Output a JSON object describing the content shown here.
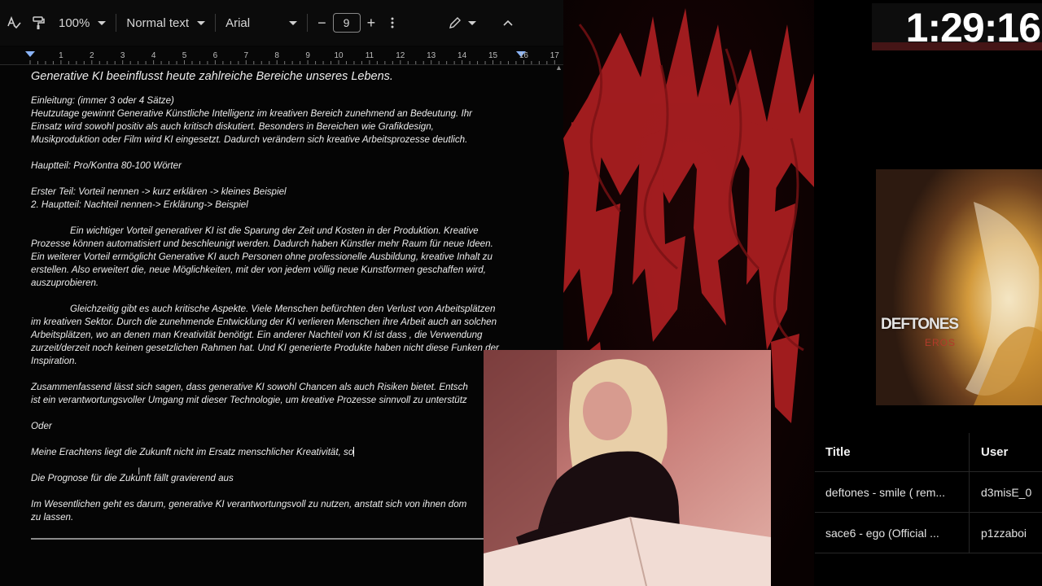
{
  "toolbar": {
    "zoom": "100%",
    "style": "Normal text",
    "font": "Arial",
    "font_size": "9",
    "minus": "−",
    "plus": "+"
  },
  "ruler": {
    "ticks": [
      "1",
      "2",
      "3",
      "4",
      "5",
      "6",
      "7",
      "8",
      "9",
      "10",
      "11",
      "12",
      "13",
      "14",
      "15",
      "16",
      "17"
    ]
  },
  "document": {
    "title": "Generative KI beeinflusst heute zahlreiche Bereiche unseres Lebens.",
    "intro_heading": "Einleitung: (immer 3 oder 4 Sätze)",
    "intro_1": "Heutzutage gewinnt Generative Künstliche Intelligenz im kreativen Bereich zunehmend an Bedeutung. Ihr",
    "intro_2": "Einsatz wird sowohl positiv als auch kritisch diskutiert. Besonders in Bereichen wie Grafikdesign,",
    "intro_3": "Musikproduktion oder Film wird KI eingesetzt. Dadurch verändern sich kreative Arbeitsprozesse deutlich.",
    "main_heading": "Hauptteil: Pro/Kontra 80-100 Wörter",
    "first_part": "Erster Teil: Vorteil nennen -> kurz erklären -> kleines Beispiel",
    "second_part": "2. Hauptteil: Nachteil nennen-> Erklärung-> Beispiel",
    "pro_1": "Ein wichtiger Vorteil generativer KI ist die Sparung der Zeit und Kosten in der Produktion. Kreative",
    "pro_2": "Prozesse können automatisiert und beschleunigt werden. Dadurch haben Künstler mehr Raum für neue Ideen.",
    "pro_3": "Ein weiterer Vorteil ermöglicht Generative KI auch Personen ohne professionelle Ausbildung, kreative Inhalt zu",
    "pro_4": "erstellen. Also erweitert die, neue Möglichkeiten, mit der von jedem völlig neue Kunstformen geschaffen wird,",
    "pro_5": "auszuprobieren.",
    "con_1": "Gleichzeitig gibt es auch kritische Aspekte. Viele Menschen befürchten den Verlust von Arbeitsplätzen",
    "con_2": "im kreativen Sektor. Durch die zunehmende Entwicklung der KI verlieren Menschen ihre Arbeit auch an solchen",
    "con_3": "Arbeitsplätzen, wo an denen man Kreativität benötigt. Ein anderer Nachteil von KI ist dass , die Verwendung",
    "con_4": "zurzeit/derzeit noch keinen gesetzlichen Rahmen hat. Und KI generierte Produkte haben nicht diese Funken der",
    "con_5": "Inspiration.",
    "sum_1": "Zusammenfassend lässt sich sagen, dass generative KI sowohl Chancen als auch Risiken bietet. Entsch",
    "sum_2": "ist ein verantwortungsvoller Umgang mit dieser Technologie, um kreative Prozesse sinnvoll zu unterstütz",
    "oder": "Oder",
    "alt_1": "Meine Erachtens liegt die Zukunft nicht im Ersatz menschlicher Kreativität, so",
    "alt_2": "Die Prognose für die Zukunft fällt gravierend aus",
    "alt_3a": "Im Wesentlichen geht es darum, generative KI verantwortungsvoll zu nutzen, anstatt sich von ihnen dom",
    "alt_3b": "zu lassen."
  },
  "timer": "1:29:16",
  "album": {
    "band": "DEFTONES",
    "subtitle": "EROS"
  },
  "song_table": {
    "headers": [
      "Title",
      "User"
    ],
    "rows": [
      {
        "title": "deftones - smile ( rem...",
        "user": "d3misE_0"
      },
      {
        "title": "sace6 - ego (Official ...",
        "user": "p1zzaboi"
      }
    ]
  },
  "colors": {
    "poster_red": "#b01f22",
    "doc_bg": "#050505"
  }
}
